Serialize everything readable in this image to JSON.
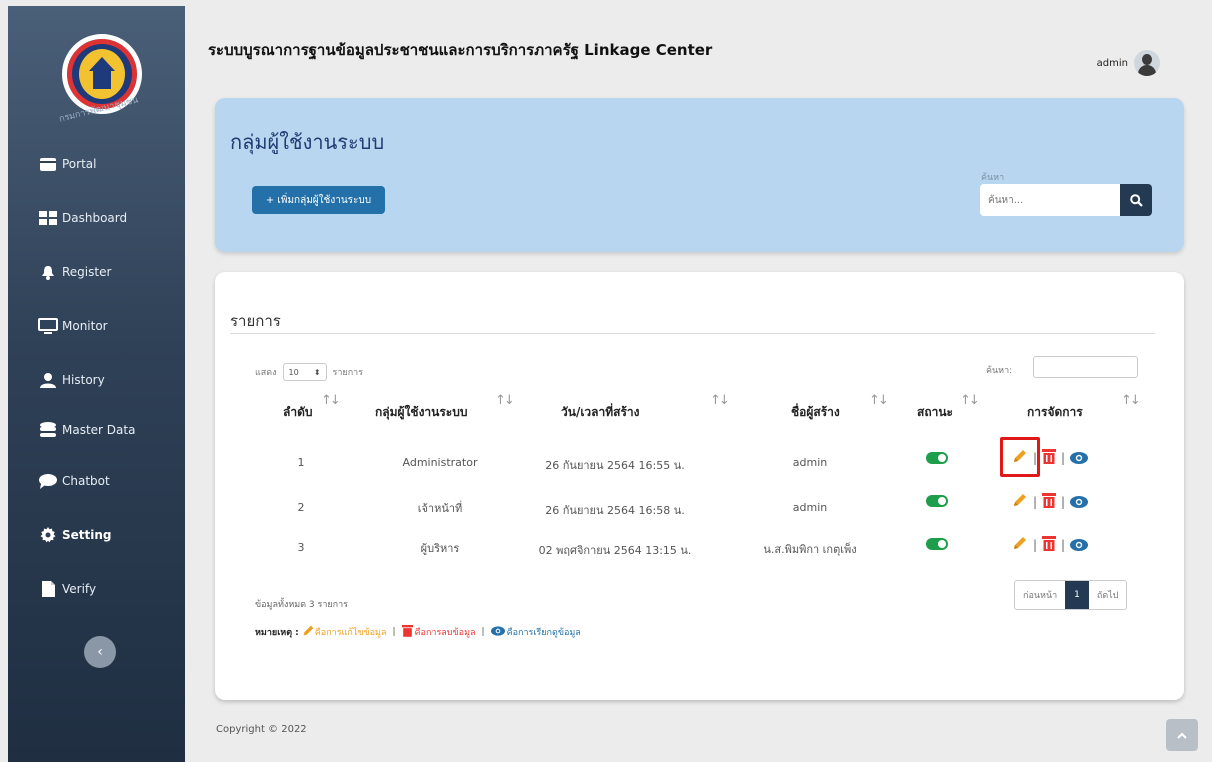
{
  "app": {
    "title": "ระบบบูรณาการฐานข้อมูลประชาชนและการบริการภาครัฐ Linkage Center",
    "user": "admin"
  },
  "sidebar": {
    "logo_caption": "กรมการพัฒนาชุมชน",
    "items": [
      {
        "label": "Portal",
        "icon": "portal-icon"
      },
      {
        "label": "Dashboard",
        "icon": "dashboard-icon"
      },
      {
        "label": "Register",
        "icon": "bell-icon"
      },
      {
        "label": "Monitor",
        "icon": "monitor-icon"
      },
      {
        "label": "History",
        "icon": "user-icon"
      },
      {
        "label": "Master Data",
        "icon": "database-icon"
      },
      {
        "label": "Chatbot",
        "icon": "chat-icon"
      },
      {
        "label": "Setting",
        "icon": "gear-icon",
        "active": true
      },
      {
        "label": "Verify",
        "icon": "file-icon"
      }
    ],
    "collapse_glyph": "‹"
  },
  "top_card": {
    "title": "กลุ่มผู้ใช้งานระบบ",
    "add_button": "+ เพิ่มกลุ่มผู้ใช้งานระบบ",
    "search_label": "ค้นหา",
    "search_placeholder": "ค้นหา..."
  },
  "list": {
    "title": "รายการ",
    "show_prefix": "แสดง",
    "show_value": "10",
    "show_suffix": "รายการ",
    "filter_label": "ค้นหา:",
    "columns": [
      "ลำดับ",
      "กลุ่มผู้ใช้งานระบบ",
      "วัน/เวลาที่สร้าง",
      "ชื่อผู้สร้าง",
      "สถานะ",
      "การจัดการ"
    ],
    "sort_glyph": "↑↓",
    "rows": [
      {
        "no": "1",
        "group": "Administrator",
        "created": "26 กันยายน 2564 16:55 น.",
        "creator": "admin",
        "status": "on"
      },
      {
        "no": "2",
        "group": "เจ้าหน้าที่",
        "created": "26 กันยายน 2564 16:58 น.",
        "creator": "admin",
        "status": "on"
      },
      {
        "no": "3",
        "group": "ผู้บริหาร",
        "created": "02 พฤศจิกายน 2564 13:15 น.",
        "creator": "น.ส.พิมพิกา เกตุเพ็ง",
        "status": "on"
      }
    ],
    "total_text": "ข้อมูลทั้งหมด 3 รายการ",
    "pager": {
      "prev": "ก่อนหน้า",
      "current": "1",
      "next": "ถัดไป"
    },
    "action_sep": "|",
    "note": {
      "prefix": "หมายเหตุ :",
      "edit": "คือการแก้ไขข้อมูล",
      "delete": "คือการลบข้อมูล",
      "view": "คือการเรียกดูข้อมูล",
      "sep": "|"
    }
  },
  "footer": {
    "copyright": "Copyright © 2022"
  },
  "colors": {
    "sidebar_top": "#4a5f78",
    "sidebar_bottom": "#1f2e41",
    "card_blue": "#b8d6ef",
    "primary": "#2470a9",
    "dark": "#233a52",
    "toggle_on": "#1e9e4a",
    "edit": "#f0a020",
    "delete": "#e33333",
    "view": "#2470a9",
    "highlight": "#e01818"
  }
}
